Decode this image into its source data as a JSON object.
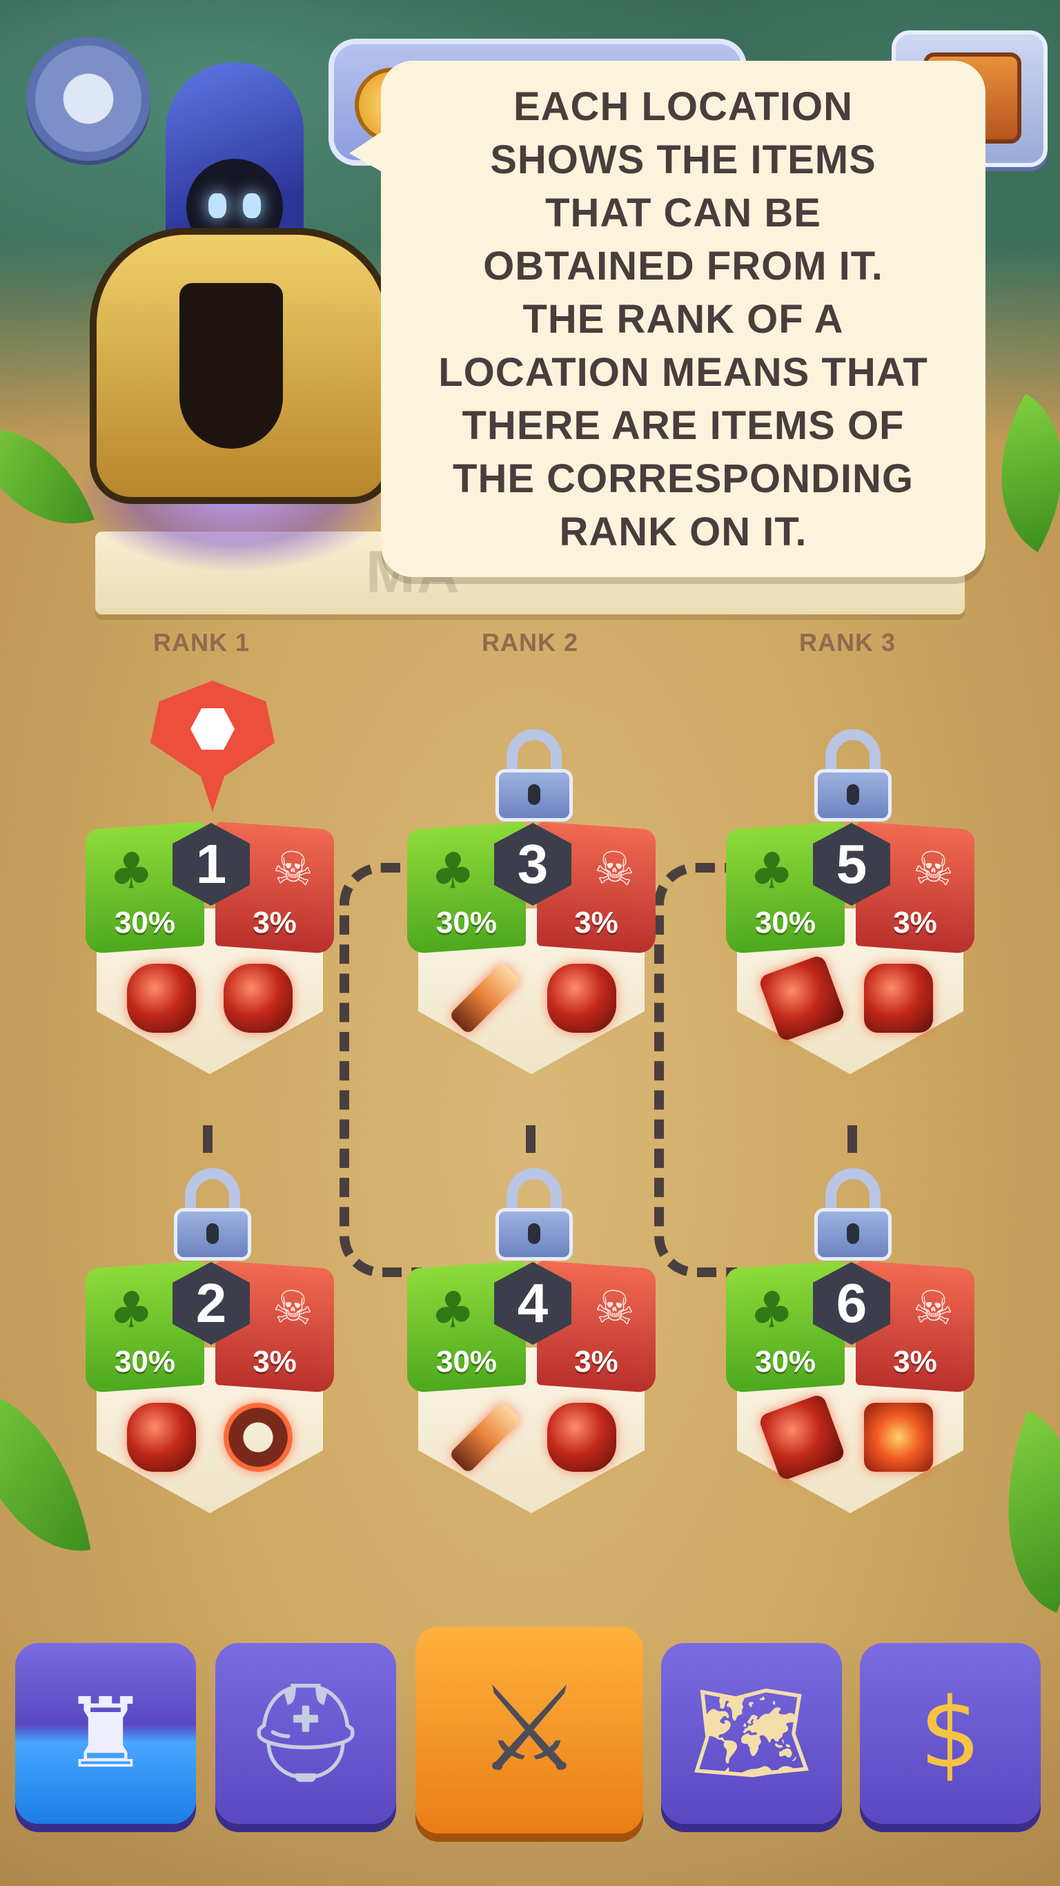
{
  "tutorial": {
    "message": "EACH LOCATION\nSHOWS THE ITEMS\nTHAT CAN BE\nOBTAINED FROM IT.\nTHE RANK OF A\nLOCATION MEANS THAT\nTHERE ARE ITEMS OF\nTHE CORRESPONDING\nRANK ON IT."
  },
  "header": {
    "banner_partial_text": "MA"
  },
  "ranks": [
    "RANK 1",
    "RANK 2",
    "RANK 3"
  ],
  "locations": [
    {
      "number": "1",
      "luck": "30%",
      "danger": "3%",
      "locked": false,
      "current": true,
      "items": [
        "demon-helmet",
        "demon-mask"
      ]
    },
    {
      "number": "2",
      "luck": "30%",
      "danger": "3%",
      "locked": true,
      "current": false,
      "items": [
        "demon-helmet",
        "fire-ring"
      ]
    },
    {
      "number": "3",
      "luck": "30%",
      "danger": "3%",
      "locked": true,
      "current": false,
      "items": [
        "flame-sword",
        "horned-helmet"
      ]
    },
    {
      "number": "4",
      "luck": "30%",
      "danger": "3%",
      "locked": true,
      "current": false,
      "items": [
        "flame-sword",
        "fire-mask"
      ]
    },
    {
      "number": "5",
      "luck": "30%",
      "danger": "3%",
      "locked": true,
      "current": false,
      "items": [
        "lava-hammer",
        "fire-armor"
      ]
    },
    {
      "number": "6",
      "luck": "30%",
      "danger": "3%",
      "locked": true,
      "current": false,
      "items": [
        "lava-hammer",
        "fire-book"
      ]
    }
  ],
  "icons": {
    "luck": "clover-icon",
    "danger": "skull-icon",
    "lock": "lock-icon",
    "marker": "location-pin-icon"
  },
  "nav": [
    {
      "name": "castle",
      "icon": "castle-icon",
      "active": false
    },
    {
      "name": "heroes",
      "icon": "helmet-icon",
      "active": false
    },
    {
      "name": "battle",
      "icon": "crossed-swords-icon",
      "active": true
    },
    {
      "name": "map",
      "icon": "treasure-map-icon",
      "active": false
    },
    {
      "name": "shop",
      "icon": "money-bag-icon",
      "active": false
    }
  ],
  "colors": {
    "luck_green": "#5bb824",
    "danger_red": "#d8423a",
    "nav_purple": "#6a5ad2",
    "nav_active_orange": "#f5962a"
  }
}
